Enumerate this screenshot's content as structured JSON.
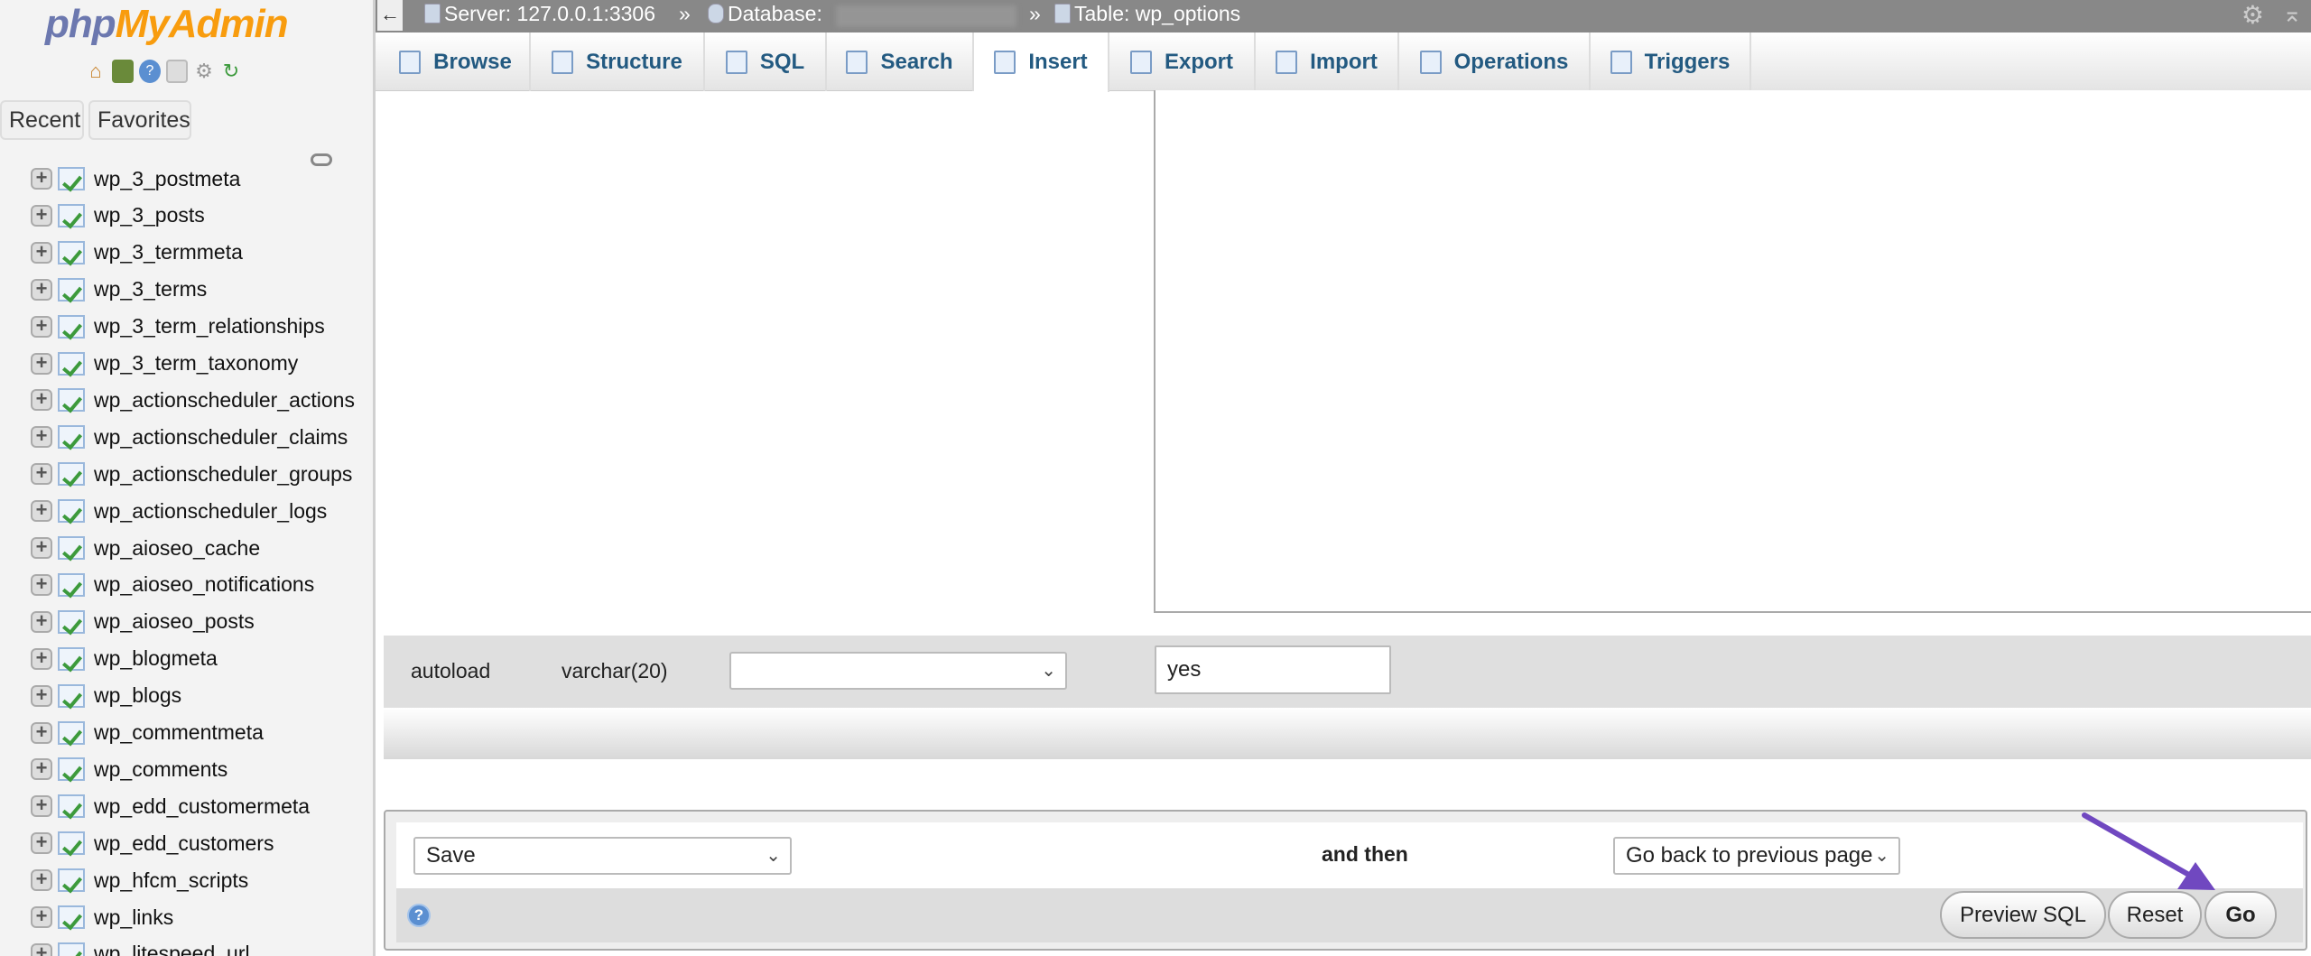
{
  "sidebar": {
    "logo_php": "php",
    "logo_myadmin": "MyAdmin",
    "nav_icons": [
      "home-icon",
      "exit-icon",
      "help-icon",
      "docs-icon",
      "settings-icon",
      "reload-icon"
    ],
    "recent": "Recent",
    "favorites": "Favorites",
    "tables": [
      "wp_3_postmeta",
      "wp_3_posts",
      "wp_3_termmeta",
      "wp_3_terms",
      "wp_3_term_relationships",
      "wp_3_term_taxonomy",
      "wp_actionscheduler_actions",
      "wp_actionscheduler_claims",
      "wp_actionscheduler_groups",
      "wp_actionscheduler_logs",
      "wp_aioseo_cache",
      "wp_aioseo_notifications",
      "wp_aioseo_posts",
      "wp_blogmeta",
      "wp_blogs",
      "wp_commentmeta",
      "wp_comments",
      "wp_edd_customermeta",
      "wp_edd_customers",
      "wp_hfcm_scripts",
      "wp_links",
      "wp_litespeed_url"
    ]
  },
  "breadcrumb": {
    "back": "←",
    "server": "Server: 127.0.0.1:3306",
    "sep": "»",
    "database": "Database:",
    "table": "Table: wp_options"
  },
  "tabs": [
    {
      "label": "Browse",
      "icon": "browse-icon"
    },
    {
      "label": "Structure",
      "icon": "structure-icon"
    },
    {
      "label": "SQL",
      "icon": "sql-icon"
    },
    {
      "label": "Search",
      "icon": "search-icon"
    },
    {
      "label": "Insert",
      "icon": "insert-icon",
      "active": true
    },
    {
      "label": "Export",
      "icon": "export-icon"
    },
    {
      "label": "Import",
      "icon": "import-icon"
    },
    {
      "label": "Operations",
      "icon": "wrench-icon"
    },
    {
      "label": "Triggers",
      "icon": "triggers-icon"
    }
  ],
  "row": {
    "column": "autoload",
    "type": "varchar(20)",
    "function": "",
    "value": "yes"
  },
  "footer": {
    "action": "Save",
    "and_then": "and then",
    "after": "Go back to previous page",
    "preview": "Preview SQL",
    "reset": "Reset",
    "go": "Go"
  },
  "annotation": {
    "arrow_color": "#7048c0"
  }
}
